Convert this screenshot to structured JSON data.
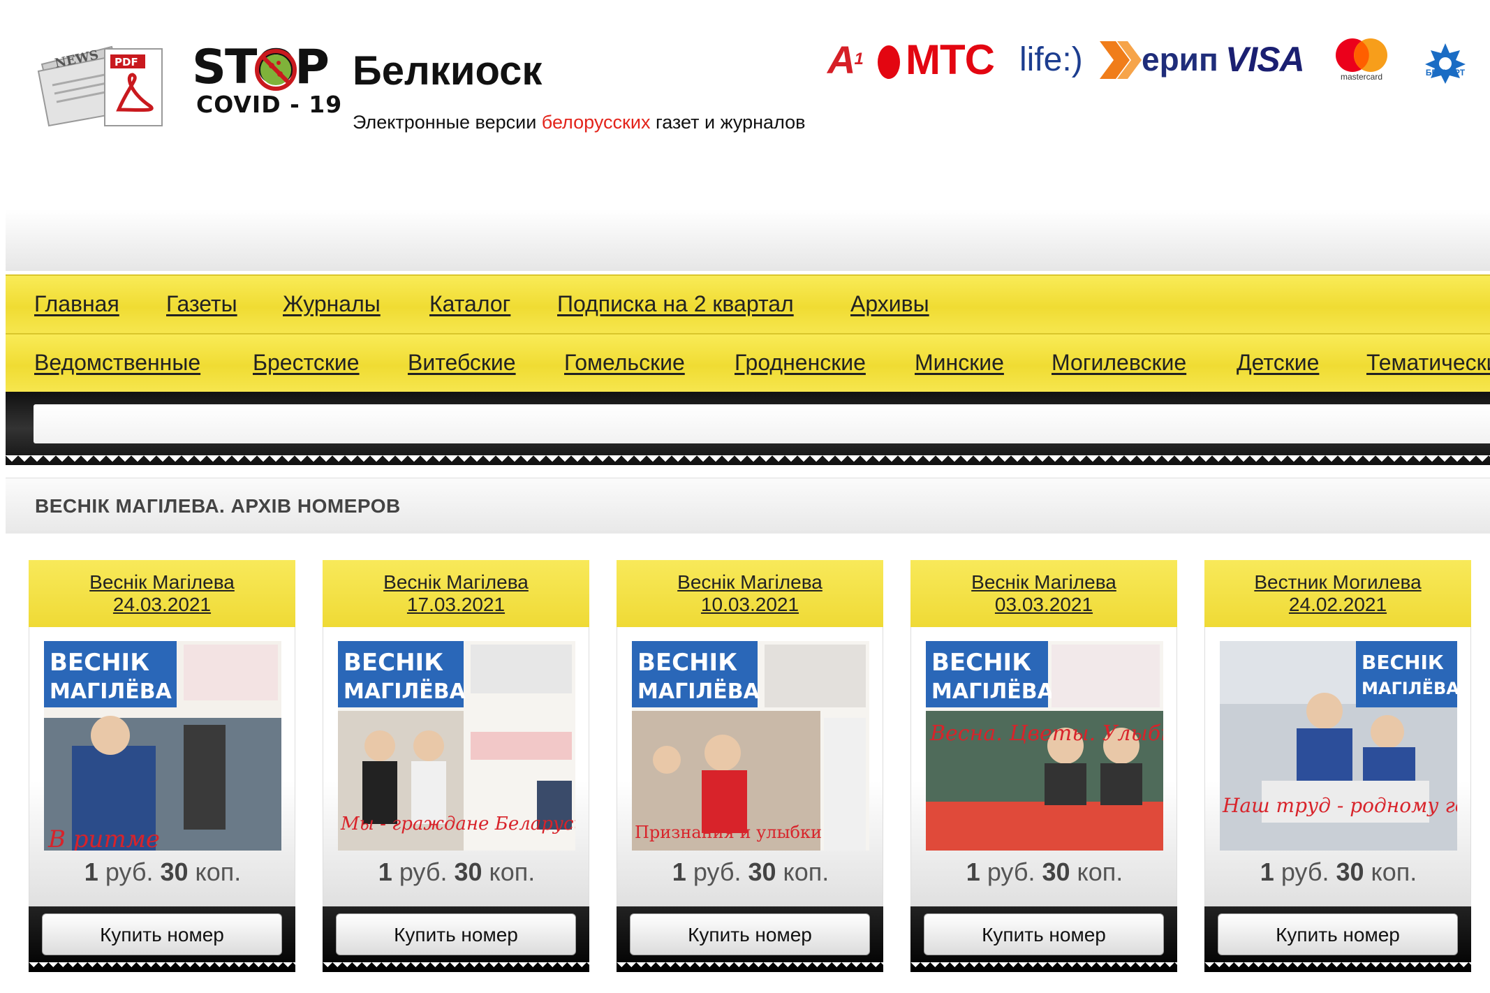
{
  "header": {
    "site_title": "Белкиоск",
    "tagline_before": "Электронные версии ",
    "tagline_accent": "белорусских",
    "tagline_after": " газет и журналов",
    "stop_word": "STOP",
    "stop_sub": "COVID - 19",
    "news_badge": "NEWS",
    "pdf_badge": "PDF"
  },
  "payments": {
    "a1": "A",
    "a1_sup": "1",
    "mts": "МТС",
    "life": "life:)",
    "erip": "ерип",
    "visa": "VISA",
    "mastercard": "mastercard",
    "belkart": "БЕЛКАРТ"
  },
  "nav_primary": [
    {
      "label": "Главная"
    },
    {
      "label": "Газеты"
    },
    {
      "label": "Журналы"
    },
    {
      "label": "Каталог"
    },
    {
      "label": "Подписка на 2 квартал"
    },
    {
      "label": "Архивы"
    }
  ],
  "nav_regions": [
    {
      "label": "Ведомственные"
    },
    {
      "label": "Брестские"
    },
    {
      "label": "Витебские"
    },
    {
      "label": "Гомельские"
    },
    {
      "label": "Гродненские"
    },
    {
      "label": "Минские"
    },
    {
      "label": "Могилевские"
    },
    {
      "label": "Детские"
    },
    {
      "label": "Тематические"
    }
  ],
  "section": {
    "title": "ВЕСНІК МАГІЛЕВА. АРХІВ НОМЕРОВ"
  },
  "cards": [
    {
      "name": "Веснік Магілева",
      "date": "24.03.2021",
      "price_rub": "1",
      "price_kop": "30",
      "buy": "Купить номер",
      "masthead_top": "ВЕСНІК",
      "masthead_bottom": "МАГІЛЁВА",
      "headline": "В ритме"
    },
    {
      "name": "Веснік Магілева",
      "date": "17.03.2021",
      "price_rub": "1",
      "price_kop": "30",
      "buy": "Купить номер",
      "masthead_top": "ВЕСНІК",
      "masthead_bottom": "МАГІЛЁВА",
      "headline": "Мы - граждане Беларуси!"
    },
    {
      "name": "Веснік Магілева",
      "date": "10.03.2021",
      "price_rub": "1",
      "price_kop": "30",
      "buy": "Купить номер",
      "masthead_top": "ВЕСНІК",
      "masthead_bottom": "МАГІЛЁВА",
      "headline": "Признания и улыбки"
    },
    {
      "name": "Веснік Магілева",
      "date": "03.03.2021",
      "price_rub": "1",
      "price_kop": "30",
      "buy": "Купить номер",
      "masthead_top": "ВЕСНІК",
      "masthead_bottom": "МАГІЛЁВА",
      "headline": "Весна. Цветы. Улыбки."
    },
    {
      "name": "Вестник Могилева",
      "date": "24.02.2021",
      "price_rub": "1",
      "price_kop": "30",
      "buy": "Купить номер",
      "masthead_top": "ВЕСНІК",
      "masthead_bottom": "МАГІЛЁВА",
      "headline": "Наш труд - родному городу!"
    }
  ],
  "labels": {
    "rub": "руб.",
    "kop": "коп."
  },
  "colors": {
    "nav_yellow": "#f0dc33",
    "accent_red": "#e3241b",
    "masthead_blue": "#2a67b8"
  }
}
